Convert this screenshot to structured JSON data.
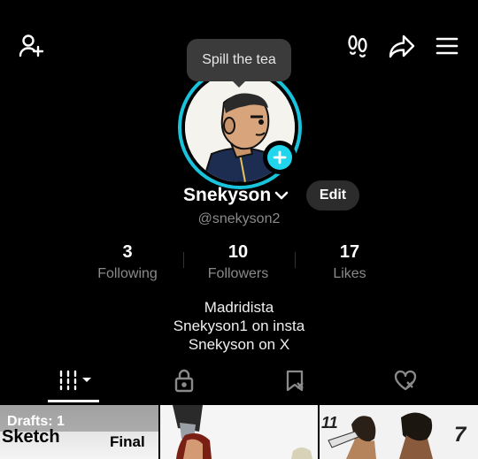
{
  "header": {
    "add_friend_icon": "person-plus-icon",
    "footprints_icon": "footprints-icon",
    "share_icon": "share-arrow-icon",
    "menu_icon": "hamburger-menu-icon"
  },
  "tooltip": {
    "text": "Spill the tea"
  },
  "profile": {
    "display_name": "Snekyson",
    "handle": "@snekyson2",
    "edit_label": "Edit",
    "ring_color": "#19c3dc",
    "badge_color": "#20d5ec"
  },
  "stats": [
    {
      "value": "3",
      "label": "Following"
    },
    {
      "value": "10",
      "label": "Followers"
    },
    {
      "value": "17",
      "label": "Likes"
    }
  ],
  "bio": {
    "lines": [
      "Madridista",
      "Snekyson1 on insta",
      "Snekyson on X"
    ]
  },
  "tabs": [
    {
      "icon": "grid-icon",
      "selected": true
    },
    {
      "icon": "lock-icon"
    },
    {
      "icon": "bookmark-icon"
    },
    {
      "icon": "heart-icon"
    }
  ],
  "grid": {
    "drafts_label": "Drafts: 1",
    "sketch_text": "Sketch",
    "final_text": "Final",
    "cell3_marks": [
      "11",
      "7"
    ]
  }
}
